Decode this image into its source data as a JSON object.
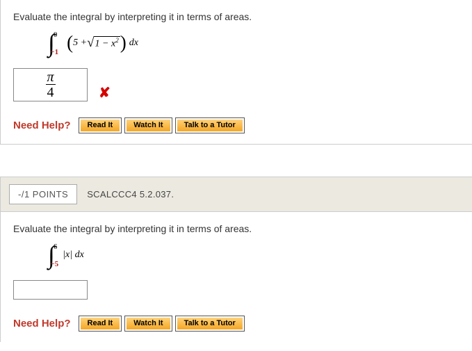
{
  "q1": {
    "prompt": "Evaluate the integral by interpreting it in terms of areas.",
    "integral_upper": "0",
    "integral_lower": "−1",
    "expr_left": "5 + ",
    "sqrt_expr": "1 − x",
    "sqrt_sup": "2",
    "expr_right": " dx",
    "user_answer_num": "π",
    "user_answer_den": "4",
    "wrong_mark": "✘"
  },
  "q2": {
    "points": "-/1 POINTS",
    "reference": "SCALCCC4 5.2.037.",
    "prompt": "Evaluate the integral by interpreting it in terms of areas.",
    "integral_upper": "6",
    "integral_lower": "−5",
    "expr": "|x| dx"
  },
  "help": {
    "label": "Need Help?",
    "read": "Read It",
    "watch": "Watch It",
    "tutor": "Talk to a Tutor"
  }
}
